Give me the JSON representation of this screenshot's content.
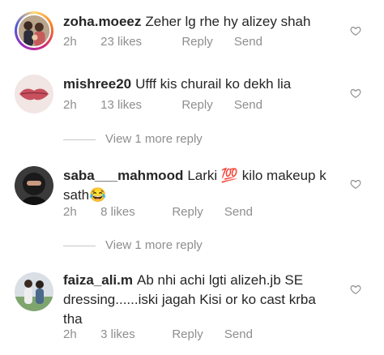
{
  "comments": [
    {
      "username": "zoha.moeez",
      "text": "Zeher lg rhe hy alizey shah",
      "time": "2h",
      "likes": "23 likes",
      "reply": "Reply",
      "send": "Send"
    },
    {
      "username": "mishree20",
      "text": "Ufff kis churail ko dekh lia",
      "time": "2h",
      "likes": "13 likes",
      "reply": "Reply",
      "send": "Send",
      "view_more": "View 1 more reply"
    },
    {
      "username": "saba___mahmood",
      "text": "Larki 💯 kilo makeup k sath😂",
      "time": "2h",
      "likes": "8 likes",
      "reply": "Reply",
      "send": "Send",
      "view_more": "View 1 more reply"
    },
    {
      "username": "faiza_ali.m",
      "text": "Ab nhi achi lgti alizeh.jb SE dressing......iski jagah Kisi or ko cast krba tha",
      "time": "2h",
      "likes": "3 likes",
      "reply": "Reply",
      "send": "Send"
    }
  ],
  "icons": {
    "like": "heart-outline-icon"
  },
  "colors": {
    "text": "#262626",
    "secondary": "#8e8e8e"
  }
}
